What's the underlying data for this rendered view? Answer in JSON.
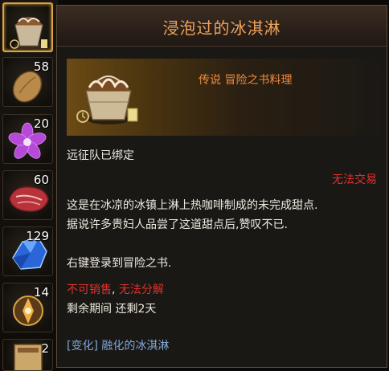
{
  "inventory": {
    "slots": [
      {
        "count": "",
        "icon": "ice-cream-icon",
        "selected": true
      },
      {
        "count": "58",
        "icon": "almond-icon"
      },
      {
        "count": "20",
        "icon": "purple-flower-icon"
      },
      {
        "count": "60",
        "icon": "raw-meat-icon"
      },
      {
        "count": "129",
        "icon": "blue-crystal-icon"
      },
      {
        "count": "14",
        "icon": "gold-ornament-icon"
      },
      {
        "count": "2",
        "icon": "scroll-icon"
      }
    ]
  },
  "tooltip": {
    "title": "浸泡过的冰淇淋",
    "rarity": "传说 冒险之书料理",
    "bound": "远征队已绑定",
    "trade": "无法交易",
    "desc1": "这是在冰凉的冰镇上淋上热咖啡制成的未完成甜点.",
    "desc2": "据说许多贵妇人品尝了这道甜点后,赞叹不已.",
    "register": "右键登录到冒险之书.",
    "no_sell": "不可销售",
    "sep": ",",
    "no_dismantle": "无法分解",
    "expiry": "剩余期间 还剩2天",
    "transform": "[变化] 融化的冰淇淋"
  },
  "colors": {
    "title": "#f0a35a",
    "rarity": "#f08a3c",
    "warning": "#e0302c",
    "link": "#7ea8d8"
  }
}
